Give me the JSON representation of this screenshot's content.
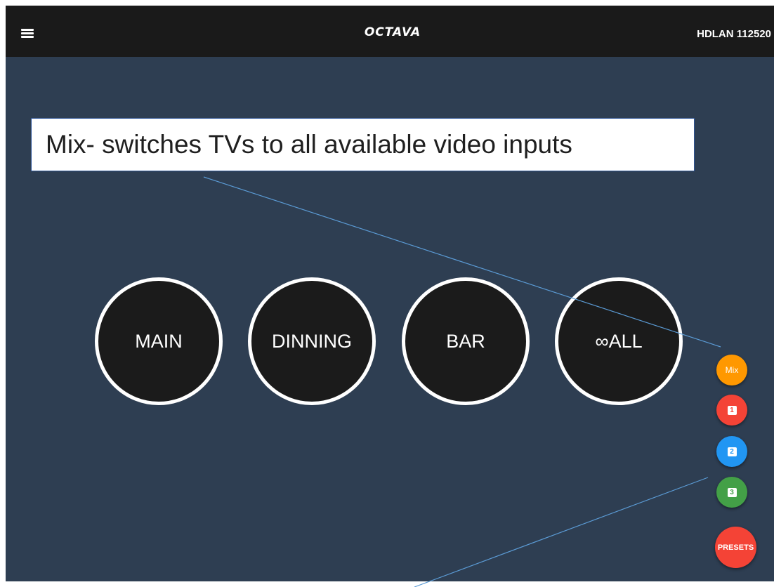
{
  "topbar": {
    "logo_text": "OCTAVA",
    "device_name": "HDLAN 112520"
  },
  "zones": [
    {
      "label": "MAIN"
    },
    {
      "label": "DINNING"
    },
    {
      "label": "BAR"
    },
    {
      "label": "∞ALL"
    }
  ],
  "fabs": {
    "mix": {
      "label": "Mix",
      "color": "#ff9800"
    },
    "preset1": {
      "label": "1",
      "color": "#f44336"
    },
    "preset2": {
      "label": "2",
      "color": "#2196f3"
    },
    "preset3": {
      "label": "3",
      "color": "#43a047"
    },
    "presets": {
      "label": "PRESETS",
      "color": "#f44336"
    }
  },
  "annotation": {
    "text": "Mix- switches TVs to all available video inputs",
    "line_color": "#5b9bd5"
  }
}
